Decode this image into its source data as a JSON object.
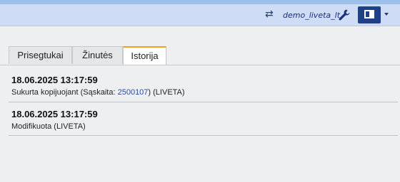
{
  "header": {
    "username": "demo_liveta_lt",
    "icons": [
      "swap-icon",
      "wrench-icon",
      "layout-panel-icon",
      "chevron-down-icon"
    ]
  },
  "tabs": [
    {
      "label": "Prisegtukai",
      "active": false
    },
    {
      "label": "Žinutės",
      "active": false
    },
    {
      "label": "Istorija",
      "active": true
    }
  ],
  "history": [
    {
      "datetime": "18.06.2025 13:17:59",
      "prefix": "Sukurta kopijuojant (Sąskaita: ",
      "link": "2500107",
      "suffix": ") (LIVETA)"
    },
    {
      "datetime": "18.06.2025 13:17:59",
      "text": "Modifikuota (LIVETA)"
    }
  ],
  "colors": {
    "header_bg": "#cfdcf6",
    "accent": "#f0a020",
    "button_bg": "#1f3f87",
    "link": "#2b4b9a"
  }
}
